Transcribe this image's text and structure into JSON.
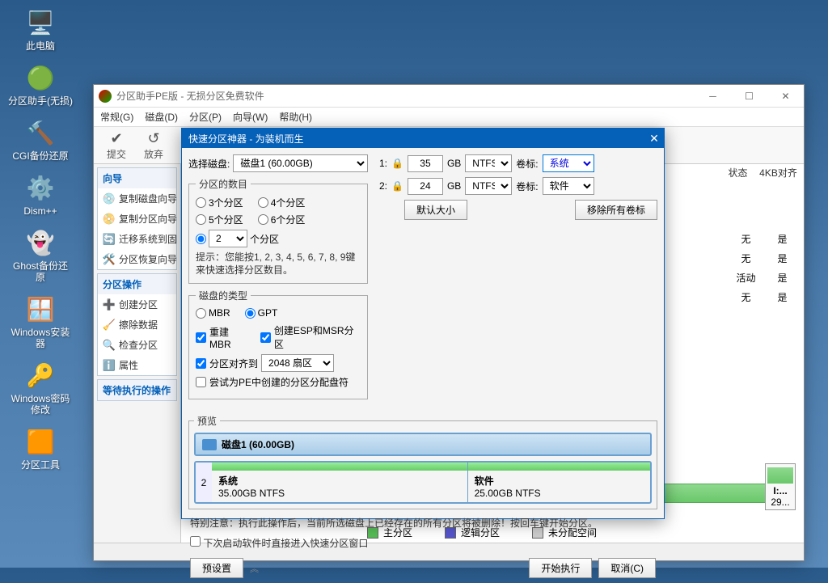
{
  "desktop": {
    "icons": [
      {
        "label": "此电脑",
        "glyph": "🖥️"
      },
      {
        "label": "分区助手(无损)",
        "glyph": "🟢"
      },
      {
        "label": "CGI备份还原",
        "glyph": "🔨"
      },
      {
        "label": "Dism++",
        "glyph": "⚙️"
      },
      {
        "label": "Ghost备份还原",
        "glyph": "👻"
      },
      {
        "label": "Windows安装器",
        "glyph": "🪟"
      },
      {
        "label": "Windows密码修改",
        "glyph": "🔑"
      },
      {
        "label": "分区工具",
        "glyph": "🟧"
      }
    ]
  },
  "app": {
    "title": "分区助手PE版 - 无损分区免费软件",
    "menus": [
      "常规(G)",
      "磁盘(D)",
      "分区(P)",
      "向导(W)",
      "帮助(H)"
    ],
    "toolbar": [
      {
        "label": "提交",
        "glyph": "✔"
      },
      {
        "label": "放弃",
        "glyph": "↺"
      }
    ],
    "header": {
      "col1": "状态",
      "col2": "4KB对齐"
    },
    "rows": [
      {
        "c1": "无",
        "c2": "是"
      },
      {
        "c1": "无",
        "c2": "是"
      },
      {
        "c1": "活动",
        "c2": "是"
      },
      {
        "c1": "无",
        "c2": "是"
      }
    ],
    "pblock": {
      "name": "I:...",
      "size": "29..."
    },
    "legend": [
      {
        "label": "主分区",
        "color": "#5b5"
      },
      {
        "label": "逻辑分区",
        "color": "#55c"
      },
      {
        "label": "未分配空间",
        "color": "#ccc"
      }
    ],
    "sidebar": {
      "g1": {
        "title": "向导",
        "items": [
          "复制磁盘向导",
          "复制分区向导",
          "迁移系统到固",
          "分区恢复向导"
        ]
      },
      "g2": {
        "title": "分区操作",
        "items": [
          "创建分区",
          "擦除数据",
          "检查分区",
          "属性"
        ]
      },
      "g3": {
        "title": "等待执行的操作"
      }
    }
  },
  "dialog": {
    "title": "快速分区神器 - 为装机而生",
    "disk_label": "选择磁盘:",
    "disk_value": "磁盘1 (60.00GB)",
    "count": {
      "title": "分区的数目",
      "opts": [
        "3个分区",
        "4个分区",
        "5个分区",
        "6个分区"
      ],
      "custom_suffix": "个分区",
      "custom_value": "2",
      "hint": "提示：您能按1, 2, 3, 4, 5, 6, 7, 8, 9键来快速选择分区数目。"
    },
    "type": {
      "title": "磁盘的类型",
      "opts": [
        "MBR",
        "GPT"
      ],
      "chk1": "重建MBR",
      "chk2": "创建ESP和MSR分区",
      "chk3_pre": "分区对齐到",
      "align_value": "2048 扇区",
      "chk4": "尝试为PE中创建的分区分配盘符"
    },
    "parts": [
      {
        "n": "1:",
        "size": "35",
        "unit": "GB",
        "fs": "NTFS",
        "vol_label": "卷标:",
        "vol": "系统"
      },
      {
        "n": "2:",
        "size": "24",
        "unit": "GB",
        "fs": "NTFS",
        "vol_label": "卷标:",
        "vol": "软件"
      }
    ],
    "btn_default": "默认大小",
    "btn_clear": "移除所有卷标",
    "preview": {
      "title": "预览",
      "disk": "磁盘1  (60.00GB)",
      "num": "2",
      "p1": {
        "name": "系统",
        "detail": "35.00GB NTFS"
      },
      "p2": {
        "name": "软件",
        "detail": "25.00GB NTFS"
      }
    },
    "warn": "特别注意：执行此操作后，当前所选磁盘上已经存在的所有分区将被删除！按回车键开始分区。",
    "chk_next": "下次启动软件时直接进入快速分区窗口",
    "btn_preset": "预设置",
    "btn_start": "开始执行",
    "btn_cancel": "取消(C)"
  }
}
